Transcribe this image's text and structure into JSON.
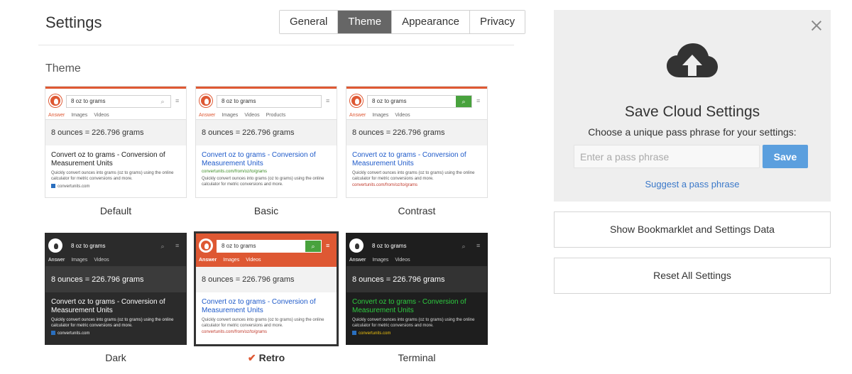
{
  "header": {
    "title": "Settings",
    "tabs": [
      {
        "label": "General"
      },
      {
        "label": "Theme",
        "active": true
      },
      {
        "label": "Appearance"
      },
      {
        "label": "Privacy"
      }
    ]
  },
  "theme_section": {
    "heading": "Theme",
    "preview": {
      "query": "8 oz to grams",
      "nav": [
        "Answer",
        "Images",
        "Videos"
      ],
      "nav_basic": [
        "Answer",
        "Images",
        "Videos",
        "Products"
      ],
      "answer": "8 ounces = 226.796 grams",
      "result_title": "Convert oz to grams - Conversion of Measurement Units",
      "result_url": "convertunits.com/from/oz/to/grams",
      "result_desc": "Quickly convert ounces into grams (oz to grams) using the online calculator for metric conversions and more.",
      "result_source": "convertunits.com"
    },
    "themes": [
      {
        "name": "Default"
      },
      {
        "name": "Basic"
      },
      {
        "name": "Contrast"
      },
      {
        "name": "Dark"
      },
      {
        "name": "Retro",
        "selected": true
      },
      {
        "name": "Terminal"
      }
    ],
    "selected_mark": "✔"
  },
  "cloud": {
    "title": "Save Cloud Settings",
    "subtitle": "Choose a unique pass phrase for your settings:",
    "input_placeholder": "Enter a pass phrase",
    "input_value": "",
    "save_label": "Save",
    "suggest_label": "Suggest a pass phrase"
  },
  "actions": {
    "bookmarklet_label": "Show Bookmarklet and Settings Data",
    "reset_label": "Reset All Settings"
  },
  "colors": {
    "accent": "#de5833",
    "active_tab": "#666666",
    "save_button": "#5b9fde",
    "link": "#3a78c9",
    "panel_bg": "#eeeeee"
  },
  "icons": {
    "cloud": "cloud-upload-icon",
    "close": "close-icon",
    "search": "search-icon",
    "menu": "hamburger-icon",
    "check": "checkmark-icon"
  }
}
